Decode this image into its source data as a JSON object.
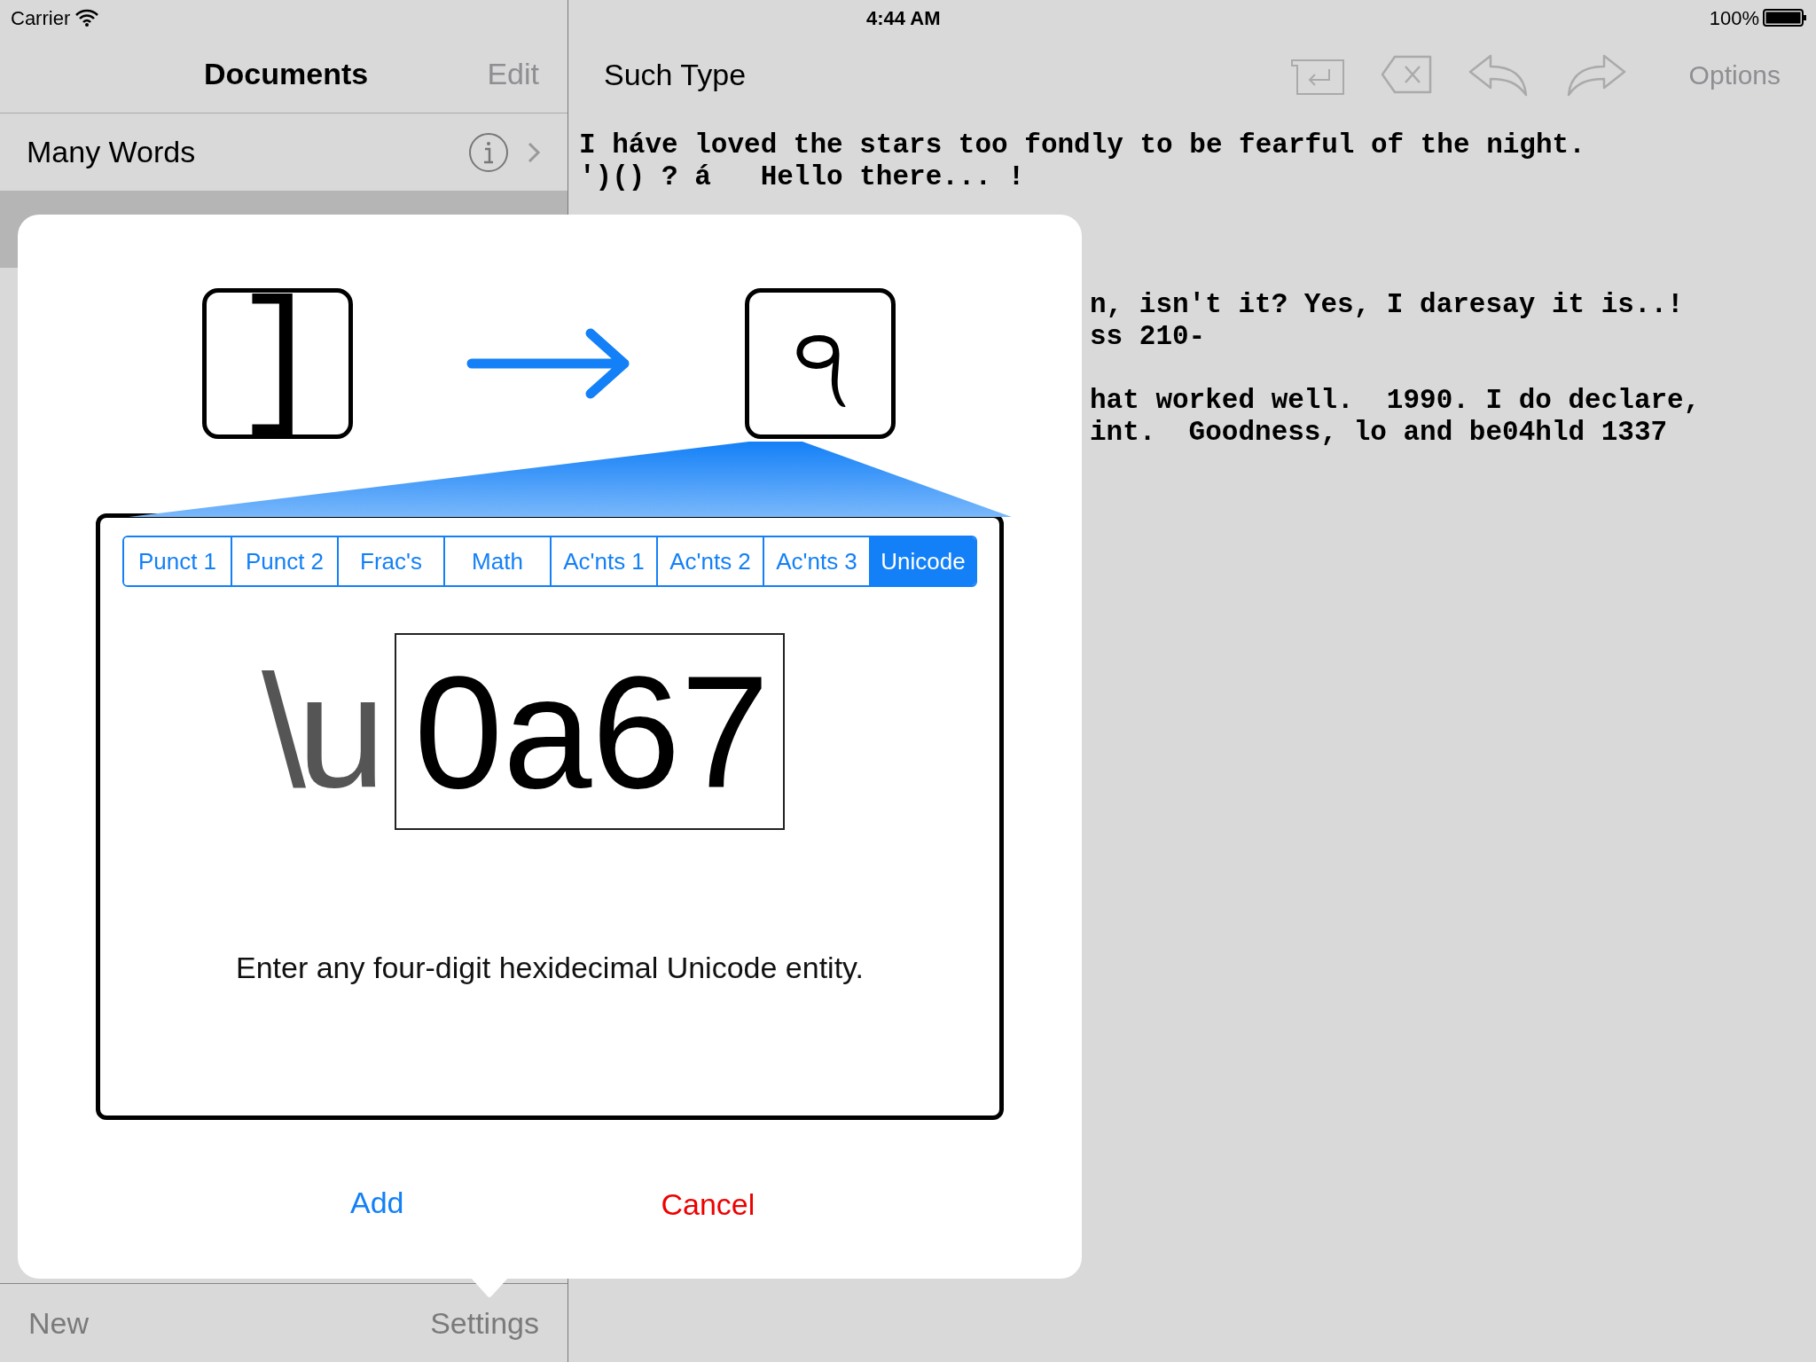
{
  "status_bar": {
    "carrier": "Carrier",
    "time": "4:44 AM",
    "battery": "100%"
  },
  "sidebar": {
    "title": "Documents",
    "edit": "Edit",
    "rows": [
      {
        "name": "Many Words",
        "selected": false
      },
      {
        "selected": true
      }
    ],
    "new": "New",
    "settings": "Settings"
  },
  "editor": {
    "title": "Such Type",
    "options": "Options",
    "lines": [
      {
        "kind": "full",
        "text": "I háve loved the stars too fondly to be fearful of the night."
      },
      {
        "kind": "full",
        "text": "')() ? á   Hello there... !"
      },
      {
        "kind": "gap"
      },
      {
        "kind": "gap"
      },
      {
        "kind": "gap"
      },
      {
        "kind": "clipped",
        "text": "n, isn't it? Yes, I daresay it is..!"
      },
      {
        "kind": "clipped",
        "text": "ss 210-"
      },
      {
        "kind": "gap"
      },
      {
        "kind": "clipped",
        "text": "hat worked well.  1990. I do declare,"
      },
      {
        "kind": "clipped",
        "text": "int.  Goodness, lo and be04hld 1337"
      }
    ]
  },
  "dialog": {
    "from_glyph": "]",
    "to_glyph": "੧",
    "tabs": [
      {
        "label": "Punct 1",
        "selected": false
      },
      {
        "label": "Punct 2",
        "selected": false
      },
      {
        "label": "Frac's",
        "selected": false
      },
      {
        "label": "Math",
        "selected": false
      },
      {
        "label": "Ac'nts 1",
        "selected": false
      },
      {
        "label": "Ac'nts 2",
        "selected": false
      },
      {
        "label": "Ac'nts 3",
        "selected": false
      },
      {
        "label": "Unicode",
        "selected": true
      }
    ],
    "prefix": "\\u",
    "code": "0a67",
    "description": "Enter any four-digit hexidecimal Unicode entity.",
    "add": "Add",
    "cancel": "Cancel"
  }
}
